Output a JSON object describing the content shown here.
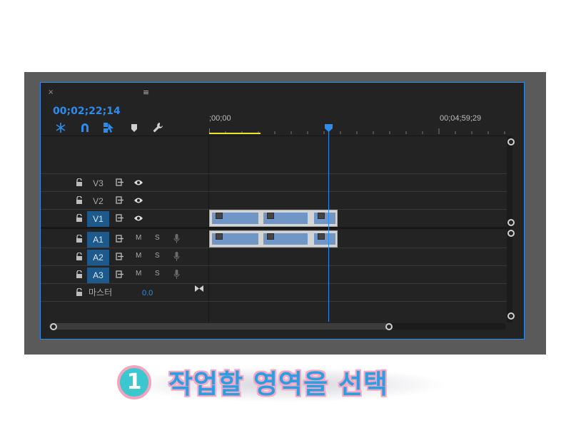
{
  "panel": {
    "close_label": "×",
    "menu_label": "≡"
  },
  "timecode": "00;02;22;14",
  "tools": [
    "snap-icon",
    "magnet-icon",
    "linked-selection-icon",
    "marker-icon",
    "wrench-icon"
  ],
  "ruler": {
    "start": ";00;00",
    "end": "00;04;59;29"
  },
  "tracks": {
    "video": [
      {
        "name": "V3",
        "active": false
      },
      {
        "name": "V2",
        "active": false
      },
      {
        "name": "V1",
        "active": true
      }
    ],
    "audio": [
      {
        "name": "A1",
        "mute": "M",
        "solo": "S"
      },
      {
        "name": "A2",
        "mute": "M",
        "solo": "S"
      },
      {
        "name": "A3",
        "mute": "M",
        "solo": "S"
      }
    ],
    "master": {
      "label": "마스터",
      "value": "0.0"
    }
  },
  "caption": {
    "number": "1",
    "text": "작업할 영역을 선택"
  },
  "colors": {
    "accent": "#2d8ceb",
    "track_active": "#1d5a8b",
    "clip": "#6f96c7",
    "workarea": "#f2e021",
    "caption_text": "#2f9ee0",
    "caption_outline": "#f7a9c4",
    "badge": "#3bc7cf"
  }
}
